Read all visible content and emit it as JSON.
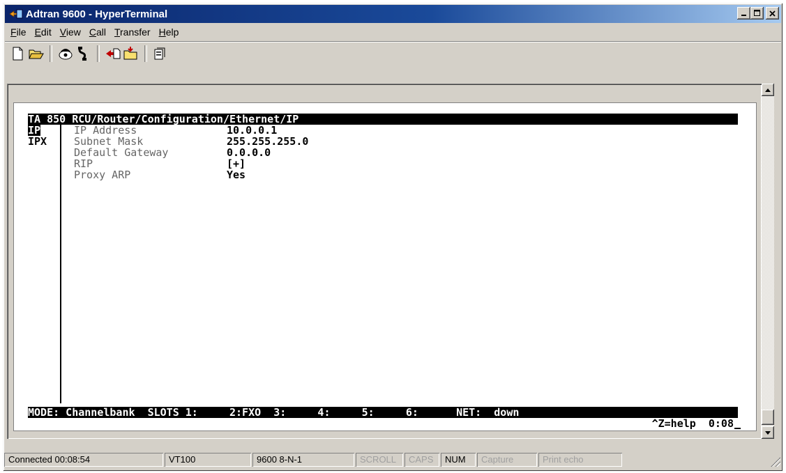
{
  "window": {
    "title": "Adtran 9600 - HyperTerminal",
    "controls": [
      "_",
      "□",
      "×"
    ]
  },
  "menubar": {
    "items": [
      "File",
      "Edit",
      "View",
      "Call",
      "Transfer",
      "Help"
    ]
  },
  "toolbar": {
    "buttons": [
      "new-icon",
      "open-icon",
      "connect-icon",
      "disconnect-icon",
      "send-icon",
      "receive-icon",
      "properties-icon"
    ]
  },
  "terminal": {
    "header": "TA 850 RCU/Router/Configuration/Ethernet/IP",
    "side_menu": [
      "IP",
      "IPX"
    ],
    "fields": [
      {
        "label": "IP Address",
        "value": "10.0.0.1"
      },
      {
        "label": "Subnet Mask",
        "value": "255.255.255.0"
      },
      {
        "label": "Default Gateway",
        "value": "0.0.0.0"
      },
      {
        "label": "RIP",
        "value": "[+]"
      },
      {
        "label": "Proxy ARP",
        "value": "Yes"
      }
    ],
    "mode_line": "MODE: Channelbank  SLOTS 1:     2:FXO  3:     4:     5:     6:      NET:  down",
    "help_line": "^Z=help  0:08"
  },
  "statusbar": {
    "connected": "Connected 00:08:54",
    "emulation": "VT100",
    "settings": "9600 8-N-1",
    "scroll": "SCROLL",
    "caps": "CAPS",
    "num": "NUM",
    "capture": "Capture",
    "print_echo": "Print echo"
  }
}
